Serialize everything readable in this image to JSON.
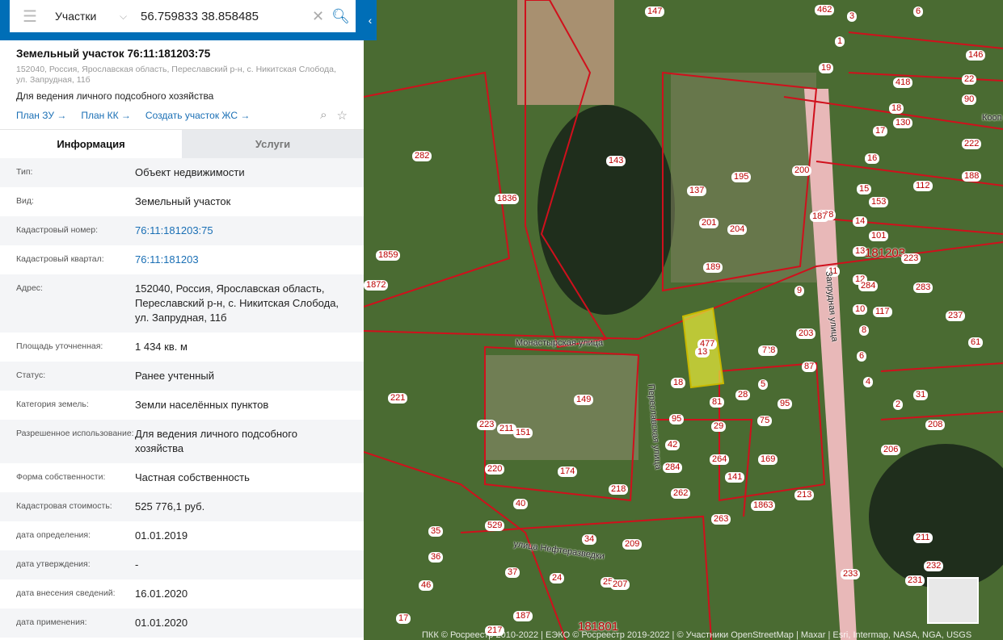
{
  "search": {
    "layer": "Участки",
    "query": "56.759833 38.858485"
  },
  "parcel": {
    "title": "Земельный участок 76:11:181203:75",
    "address": "152040, Россия, Ярославская область, Переславский р-н, с. Никитская Слобода, ул. Запрудная, 11б",
    "purpose": "Для ведения личного подсобного хозяйства",
    "links": [
      "План ЗУ →",
      "План КК →",
      "Создать участок ЖС →"
    ]
  },
  "tabs": [
    "Информация",
    "Услуги"
  ],
  "info": [
    {
      "k": "Тип:",
      "v": "Объект недвижимости"
    },
    {
      "k": "Вид:",
      "v": "Земельный участок"
    },
    {
      "k": "Кадастровый номер:",
      "v": "76:11:181203:75",
      "link": true
    },
    {
      "k": "Кадастровый квартал:",
      "v": "76:11:181203",
      "link": true
    },
    {
      "k": "Адрес:",
      "v": "152040, Россия, Ярославская область, Переславский р-н, с. Никитская Слобода, ул. Запрудная, 11б"
    },
    {
      "k": "Площадь уточненная:",
      "v": "1 434 кв. м"
    },
    {
      "k": "Статус:",
      "v": "Ранее учтенный"
    },
    {
      "k": "Категория земель:",
      "v": "Земли населённых пунктов"
    },
    {
      "k": "Разрешенное использование:",
      "v": "Для ведения личного подсобного хозяйства"
    },
    {
      "k": "Форма собственности:",
      "v": "Частная собственность"
    },
    {
      "k": "Кадастровая стоимость:",
      "v": "525 776,1 руб."
    },
    {
      "k": "дата определения:",
      "v": "01.01.2019"
    },
    {
      "k": "дата утверждения:",
      "v": "-"
    },
    {
      "k": "дата внесения сведений:",
      "v": "16.01.2020"
    },
    {
      "k": "дата применения:",
      "v": "01.01.2020"
    }
  ],
  "map": {
    "labels": [
      "147",
      "462",
      "3",
      "6",
      "1",
      "19",
      "146",
      "418",
      "22",
      "90",
      "18",
      "130",
      "17",
      "222",
      "188",
      "16",
      "112",
      "15",
      "153",
      "14",
      "101",
      "13",
      "181203",
      "223",
      "12",
      "284",
      "283",
      "10",
      "117",
      "237",
      "8",
      "61",
      "6",
      "4",
      "31",
      "2",
      "208",
      "206",
      "143",
      "137",
      "195",
      "200",
      "204",
      "201",
      "189",
      "198",
      "187",
      "11",
      "9",
      "203",
      "228",
      "7",
      "87",
      "5",
      "95",
      "75",
      "477",
      "13",
      "18",
      "81",
      "28",
      "95",
      "29",
      "42",
      "284",
      "264",
      "141",
      "169",
      "213",
      "262",
      "263",
      "1863",
      "282",
      "1836",
      "1859",
      "1872",
      "221",
      "149",
      "223",
      "211",
      "151",
      "220",
      "174",
      "218",
      "40",
      "529",
      "35",
      "34",
      "209",
      "36",
      "37",
      "24",
      "25",
      "207",
      "46",
      "17",
      "217",
      "181801",
      "187",
      "233",
      "211",
      "232",
      "231"
    ],
    "streets": [
      "Монастырская улица",
      "Переславская улица",
      "Запрудная улица",
      "улица Нефтеразведки",
      "Кооп"
    ],
    "attribution": "ПКК © Росреестр 2010-2022 | ЕЭКО © Росреестр 2019-2022 | © Участники OpenStreetMap | Maxar | Esri, Intermap, NASA, NGA, USGS"
  }
}
